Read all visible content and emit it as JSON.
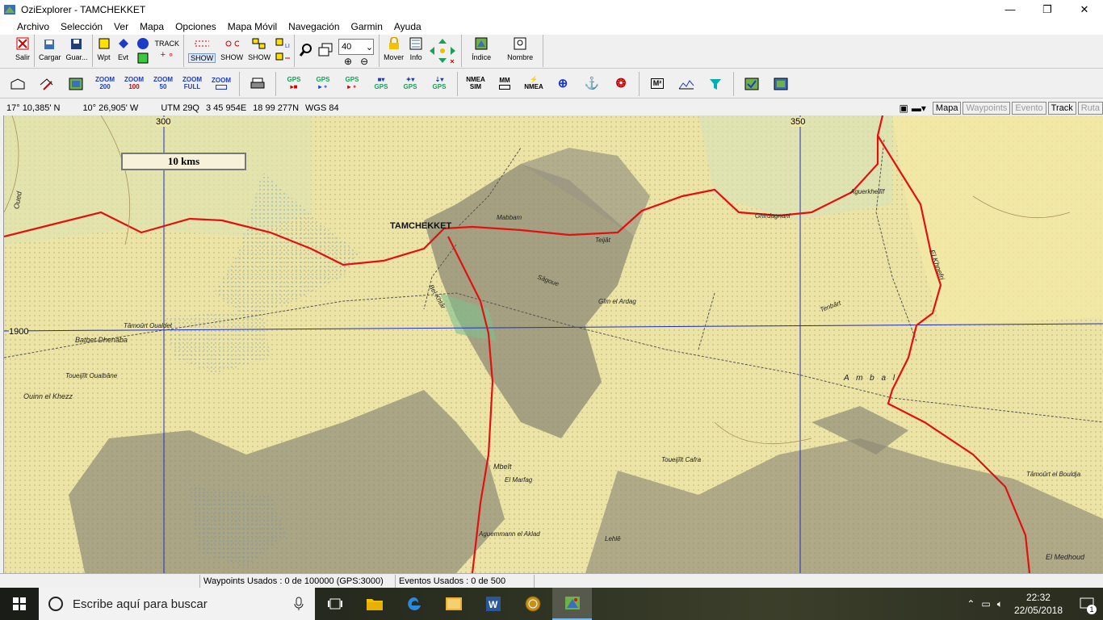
{
  "window": {
    "title": "OziExplorer - TAMCHEKKET",
    "minimize": "—",
    "maximize": "❐",
    "close": "✕"
  },
  "menu": [
    "Archivo",
    "Selección",
    "Ver",
    "Mapa",
    "Opciones",
    "Mapa Móvil",
    "Navegación",
    "Garmin",
    "Ayuda"
  ],
  "toolbar1": {
    "salir": "Salir",
    "cargar": "Cargar",
    "guardar": "Guar...",
    "wpt": "Wpt",
    "evt": "Evt",
    "track": "TRACK",
    "show": "SHOW",
    "line": "LINE",
    "zoom_value": "40",
    "mover": "Mover",
    "info": "Info",
    "indice": "Índice",
    "nombre": "Nombre"
  },
  "toolbar2": {
    "zoom200": [
      "ZOOM",
      "200"
    ],
    "zoom100": [
      "ZOOM",
      "100"
    ],
    "zoom50": [
      "ZOOM",
      "50"
    ],
    "zoomfull": [
      "ZOOM",
      "FULL"
    ],
    "zoomx": [
      "ZOOM",
      ""
    ],
    "gps1": "GPS",
    "gps2": "GPS",
    "gps3": "GPS",
    "gps4": "GPS",
    "gps5": "GPS",
    "gps6": "GPS",
    "nmea": [
      "NMEA",
      "SIM"
    ],
    "mm": [
      "MM",
      ""
    ],
    "nmea2": "NMEA",
    "m2": "M²"
  },
  "status": {
    "lat": "17° 10,385' N",
    "lon": "10° 26,905' W",
    "utm": "UTM  29Q",
    "easting": "3 45 954E",
    "northing": "18 99 277N",
    "datum": "WGS 84"
  },
  "mode_tabs": [
    "Mapa",
    "Waypoints",
    "Evento",
    "Track",
    "Ruta"
  ],
  "map": {
    "scale": "10 kms",
    "grid_x": [
      "300",
      "350"
    ],
    "grid_y": [
      "1900"
    ],
    "city": "TAMCHEKKET",
    "labels": [
      "Oued",
      "Batbet Dhenâba",
      "Ouinn el Khezz",
      "Tâmoûrt Oualdet",
      "Toueijîlt Oualbâne",
      "Mabbam",
      "Teijât",
      "Gîm el Ardag",
      "Ghirdagnani",
      "Aguerkhellîf",
      "El Khnefri",
      "Tenbârt",
      "Bel Khtâr",
      "Sâgoue",
      "Mbeît",
      "El Marfag",
      "Toueijîlt Cafra",
      "Aguemmann el Aklad",
      "Lehlê",
      "El Medhoud",
      "Tâmoûrt el Bouldja",
      "A m b a l"
    ]
  },
  "statusbar": {
    "waypoints": "Waypoints Usados : 0 de 100000  (GPS:3000)",
    "eventos": "Eventos Usados : 0 de 500"
  },
  "taskbar": {
    "search": "Escribe aquí para buscar",
    "time": "22:32",
    "date": "22/05/2018",
    "notif_count": "1"
  }
}
